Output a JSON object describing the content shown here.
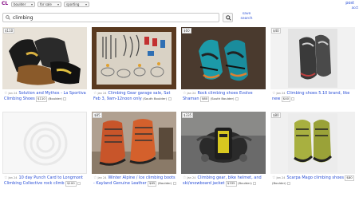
{
  "header": {
    "logo": "CL",
    "location": "boulder",
    "category": "for sale",
    "subcategory": "sporting",
    "post_label": "post",
    "account_label": "acct"
  },
  "search": {
    "query": "climbing",
    "save_search_line1": "save",
    "save_search_line2": "search"
  },
  "listings": [
    {
      "price_badge": "$110",
      "date": "Jan 24",
      "title": "Solution and Mythos - La Sportiva Climbing Shoes",
      "price": "$110",
      "hood": "(Boulder)"
    },
    {
      "price_badge": "",
      "date": "Jan 24",
      "title": "Climbing Gear garage sale, Sat Feb 3, 9am-12noon only",
      "price": "",
      "hood": "(South Boulder)"
    },
    {
      "price_badge": "$60",
      "date": "Jan 24",
      "title": "Rock climbing shoes Evolve Shaman",
      "price": "$60",
      "hood": "(South Boulder)"
    },
    {
      "price_badge": "$40",
      "date": "Jan 24",
      "title": "Climbing shoes 5.10 brand, like new",
      "price": "$40",
      "hood": ""
    },
    {
      "price_badge": "",
      "date": "Jan 24",
      "title": "10 day Punch Card to Longmont Climbing Collective rock climb",
      "price": "$100",
      "hood": ""
    },
    {
      "price_badge": "$85",
      "date": "Jan 24",
      "title": "Winter Alpine / Ice climbing boots - Kayland Genuine Leather",
      "price": "$85",
      "hood": "(Boulder)"
    },
    {
      "price_badge": "$335",
      "date": "Jan 24",
      "title": "Climbing gear, bike helmet, and ski/snowboard jacket",
      "price": "$335",
      "hood": "(Boulder)"
    },
    {
      "price_badge": "$80",
      "date": "Jan 24",
      "title": "Scarpa Mago climbing shoes",
      "price": "$80",
      "hood": "(Boulder)"
    }
  ]
}
